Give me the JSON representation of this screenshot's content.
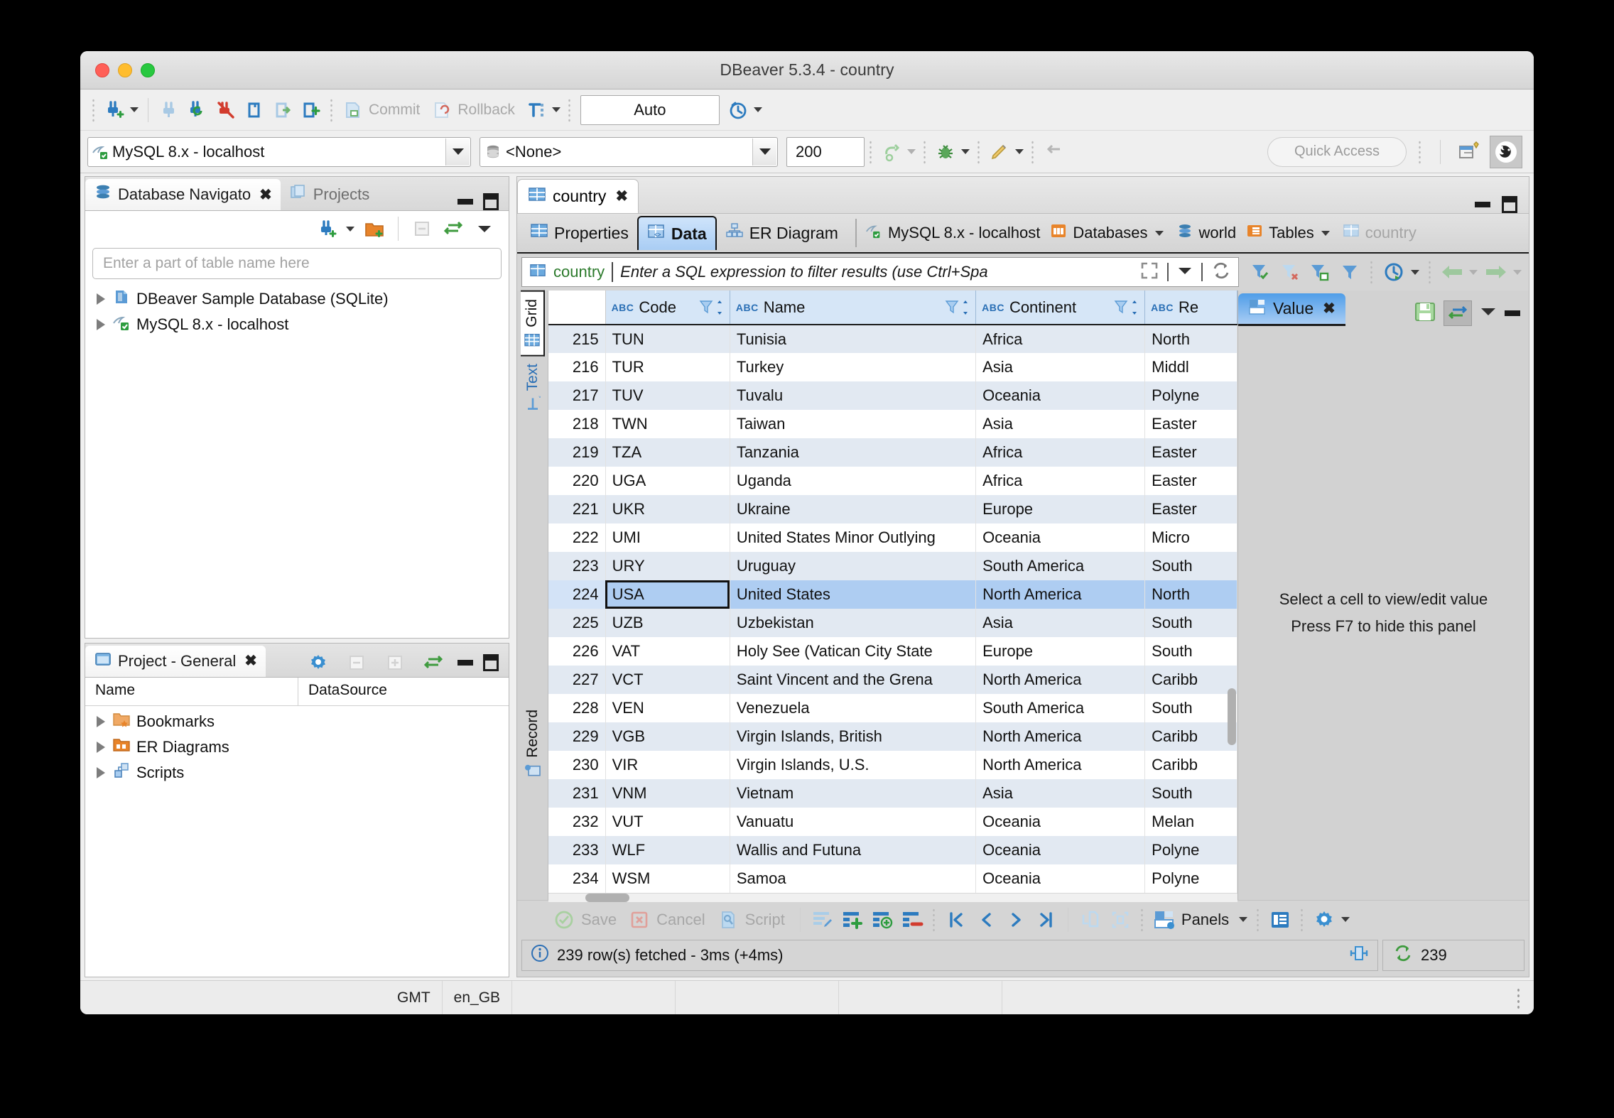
{
  "window": {
    "title": "DBeaver 5.3.4 - country"
  },
  "toolbar_main": {
    "commit_label": "Commit",
    "rollback_label": "Rollback",
    "auto_commit_value": "Auto",
    "icons": [
      "new-connection-icon",
      "connect-icon",
      "refresh-connection-icon",
      "disconnect-icon",
      "sql-editor-icon",
      "open-sql-script-icon",
      "new-sql-editor-icon",
      "commit-icon",
      "rollback-icon",
      "transaction-mode-icon",
      "transaction-log-icon"
    ]
  },
  "toolbar_connection": {
    "datasource_value": "MySQL 8.x - localhost",
    "database_value": "<None>",
    "fetch_size_value": "200",
    "quick_access_placeholder": "Quick Access"
  },
  "navigator": {
    "tabs": [
      {
        "label": "Database Navigato",
        "icon": "database-navigator-icon",
        "active": true,
        "closable": true
      },
      {
        "label": "Projects",
        "icon": "projects-icon",
        "active": false,
        "closable": false
      }
    ],
    "search_placeholder": "Enter a part of table name here",
    "tree": [
      {
        "label": "DBeaver Sample Database (SQLite)",
        "icon": "sqlite-database-icon"
      },
      {
        "label": "MySQL 8.x - localhost",
        "icon": "mysql-database-icon"
      }
    ]
  },
  "project_panel": {
    "tab_label": "Project - General",
    "columns": [
      "Name",
      "DataSource"
    ],
    "rows": [
      {
        "name": "Bookmarks",
        "icon": "bookmarks-folder-icon",
        "datasource": ""
      },
      {
        "name": "ER Diagrams",
        "icon": "er-diagrams-folder-icon",
        "datasource": ""
      },
      {
        "name": "Scripts",
        "icon": "scripts-folder-icon",
        "datasource": ""
      }
    ]
  },
  "editor": {
    "tab_label": "country",
    "subtabs": [
      {
        "label": "Properties",
        "icon": "properties-icon",
        "active": false
      },
      {
        "label": "Data",
        "icon": "data-grid-icon",
        "active": true
      },
      {
        "label": "ER Diagram",
        "icon": "er-diagram-icon",
        "active": false
      }
    ],
    "breadcrumbs": [
      {
        "label": "MySQL 8.x - localhost",
        "icon": "mysql-connection-icon",
        "caret": false,
        "dim": false
      },
      {
        "label": "Databases",
        "icon": "databases-icon",
        "caret": true,
        "dim": false
      },
      {
        "label": "world",
        "icon": "schema-icon",
        "caret": false,
        "dim": false
      },
      {
        "label": "Tables",
        "icon": "tables-folder-icon",
        "caret": true,
        "dim": false
      },
      {
        "label": "country",
        "icon": "table-icon",
        "caret": false,
        "dim": true
      }
    ],
    "filter": {
      "table_name": "country",
      "placeholder": "Enter a SQL expression to filter results (use Ctrl+Spa",
      "buttons": [
        "apply-filter-icon",
        "clear-filter-icon",
        "save-filter-icon",
        "filter-menu-icon",
        "history-icon",
        "back-icon",
        "forward-icon"
      ]
    },
    "presentation_tabs": [
      {
        "label": "Grid",
        "icon": "grid-icon",
        "active": true
      },
      {
        "label": "Text",
        "icon": "text-icon",
        "active": false
      },
      {
        "label": "Record",
        "icon": "record-icon",
        "active": false
      }
    ]
  },
  "grid": {
    "columns": [
      {
        "name": "Code",
        "type_badge": "ABC",
        "sortable": true,
        "key": true
      },
      {
        "name": "Name",
        "type_badge": "ABC",
        "sortable": true,
        "key": false
      },
      {
        "name": "Continent",
        "type_badge": "ABC",
        "sortable": true,
        "key": false
      },
      {
        "name": "Re",
        "type_badge": "ABC",
        "sortable": false,
        "key": false
      }
    ],
    "selected_row_index": 9,
    "focused_cell_column": 0,
    "rows": [
      {
        "n": "215",
        "Code": "TUN",
        "Name": "Tunisia",
        "Continent": "Africa",
        "Region": "North"
      },
      {
        "n": "216",
        "Code": "TUR",
        "Name": "Turkey",
        "Continent": "Asia",
        "Region": "Middl"
      },
      {
        "n": "217",
        "Code": "TUV",
        "Name": "Tuvalu",
        "Continent": "Oceania",
        "Region": "Polyne"
      },
      {
        "n": "218",
        "Code": "TWN",
        "Name": "Taiwan",
        "Continent": "Asia",
        "Region": "Easter"
      },
      {
        "n": "219",
        "Code": "TZA",
        "Name": "Tanzania",
        "Continent": "Africa",
        "Region": "Easter"
      },
      {
        "n": "220",
        "Code": "UGA",
        "Name": "Uganda",
        "Continent": "Africa",
        "Region": "Easter"
      },
      {
        "n": "221",
        "Code": "UKR",
        "Name": "Ukraine",
        "Continent": "Europe",
        "Region": "Easter"
      },
      {
        "n": "222",
        "Code": "UMI",
        "Name": "United States Minor Outlying",
        "Continent": "Oceania",
        "Region": "Micro"
      },
      {
        "n": "223",
        "Code": "URY",
        "Name": "Uruguay",
        "Continent": "South America",
        "Region": "South"
      },
      {
        "n": "224",
        "Code": "USA",
        "Name": "United States",
        "Continent": "North America",
        "Region": "North"
      },
      {
        "n": "225",
        "Code": "UZB",
        "Name": "Uzbekistan",
        "Continent": "Asia",
        "Region": "South"
      },
      {
        "n": "226",
        "Code": "VAT",
        "Name": "Holy See (Vatican City State",
        "Continent": "Europe",
        "Region": "South"
      },
      {
        "n": "227",
        "Code": "VCT",
        "Name": "Saint Vincent and the Grena",
        "Continent": "North America",
        "Region": "Caribb"
      },
      {
        "n": "228",
        "Code": "VEN",
        "Name": "Venezuela",
        "Continent": "South America",
        "Region": "South"
      },
      {
        "n": "229",
        "Code": "VGB",
        "Name": "Virgin Islands, British",
        "Continent": "North America",
        "Region": "Caribb"
      },
      {
        "n": "230",
        "Code": "VIR",
        "Name": "Virgin Islands, U.S.",
        "Continent": "North America",
        "Region": "Caribb"
      },
      {
        "n": "231",
        "Code": "VNM",
        "Name": "Vietnam",
        "Continent": "Asia",
        "Region": "South"
      },
      {
        "n": "232",
        "Code": "VUT",
        "Name": "Vanuatu",
        "Continent": "Oceania",
        "Region": "Melan"
      },
      {
        "n": "233",
        "Code": "WLF",
        "Name": "Wallis and Futuna",
        "Continent": "Oceania",
        "Region": "Polyne"
      },
      {
        "n": "234",
        "Code": "WSM",
        "Name": "Samoa",
        "Continent": "Oceania",
        "Region": "Polyne"
      }
    ]
  },
  "value_panel": {
    "tab_label": "Value",
    "hint_line1": "Select a cell to view/edit value",
    "hint_line2": "Press F7 to hide this panel",
    "buttons": [
      "save-value-icon",
      "auto-apply-icon",
      "panel-menu-icon",
      "minimize-icon"
    ]
  },
  "bottom_toolbar": {
    "save_label": "Save",
    "cancel_label": "Cancel",
    "script_label": "Script",
    "panels_label": "Panels",
    "icons": [
      "edit-row-icon",
      "add-row-icon",
      "duplicate-row-icon",
      "delete-row-icon",
      "first-row-icon",
      "prev-row-icon",
      "next-row-icon",
      "last-row-icon",
      "export-icon",
      "calc-icon",
      "panels-icon",
      "record-mode-icon",
      "config-icon"
    ]
  },
  "status": {
    "message": "239 row(s) fetched - 3ms (+4ms)",
    "row_count": "239",
    "timezone": "GMT",
    "locale": "en_GB"
  }
}
